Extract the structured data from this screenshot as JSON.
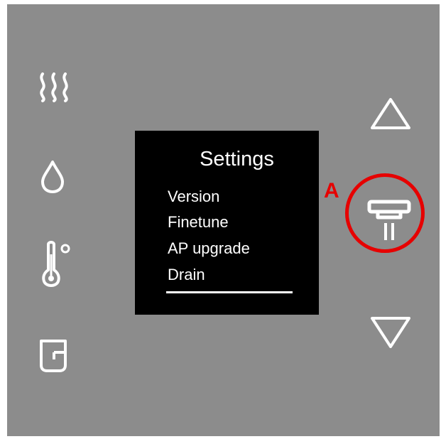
{
  "screen": {
    "title": "Settings",
    "menu": [
      "Version",
      "Finetune",
      "AP upgrade",
      "Drain"
    ],
    "selected_index": 3
  },
  "left_icons": [
    "steam-icon",
    "water-drop-icon",
    "thermometer-icon",
    "cup-icon"
  ],
  "right_controls": [
    "up-arrow-button",
    "dispense-button",
    "down-arrow-button"
  ],
  "annotation": {
    "label": "A",
    "color": "#e60000"
  },
  "colors": {
    "panel": "#8c8c8c",
    "screen": "#000000",
    "icon": "#ffffff"
  }
}
